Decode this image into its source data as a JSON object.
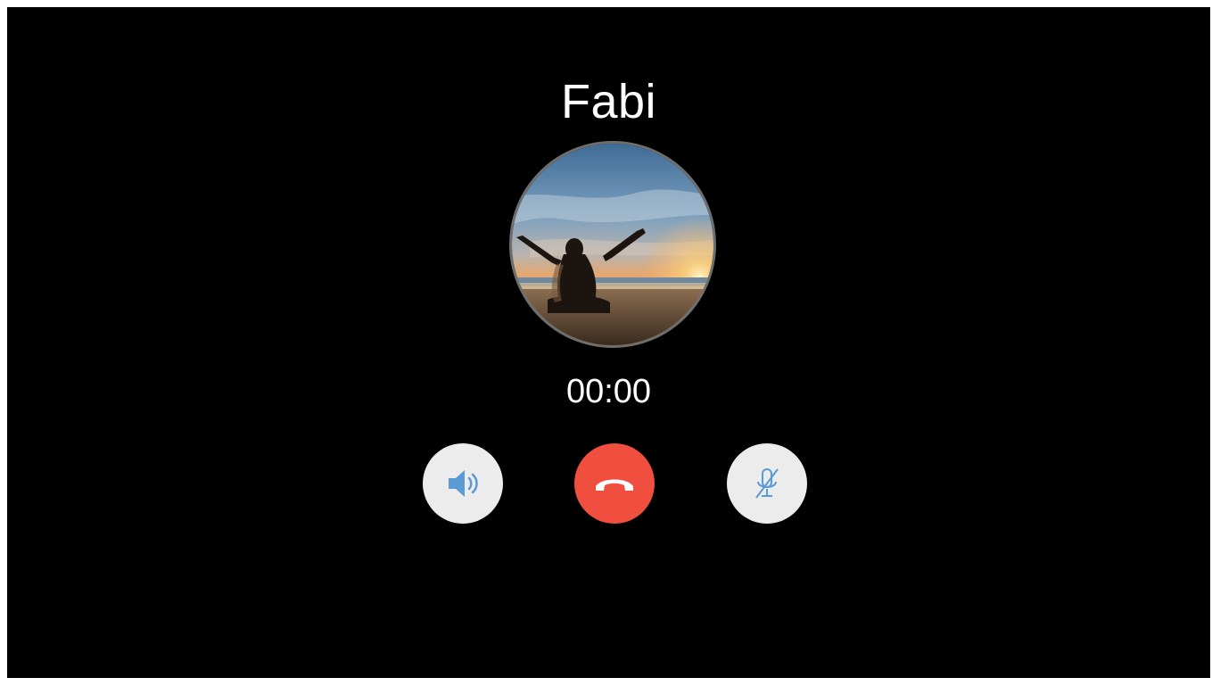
{
  "call": {
    "caller_name": "Fabi",
    "timer": "00:00"
  },
  "controls": {
    "speaker": {
      "icon": "speaker-icon"
    },
    "end_call": {
      "icon": "phone-hangup-icon"
    },
    "mute": {
      "icon": "microphone-off-icon"
    }
  },
  "colors": {
    "background": "#000000",
    "end_call": "#f04e3e",
    "control_bg": "#ececec",
    "control_icon": "#5b9bd5"
  }
}
